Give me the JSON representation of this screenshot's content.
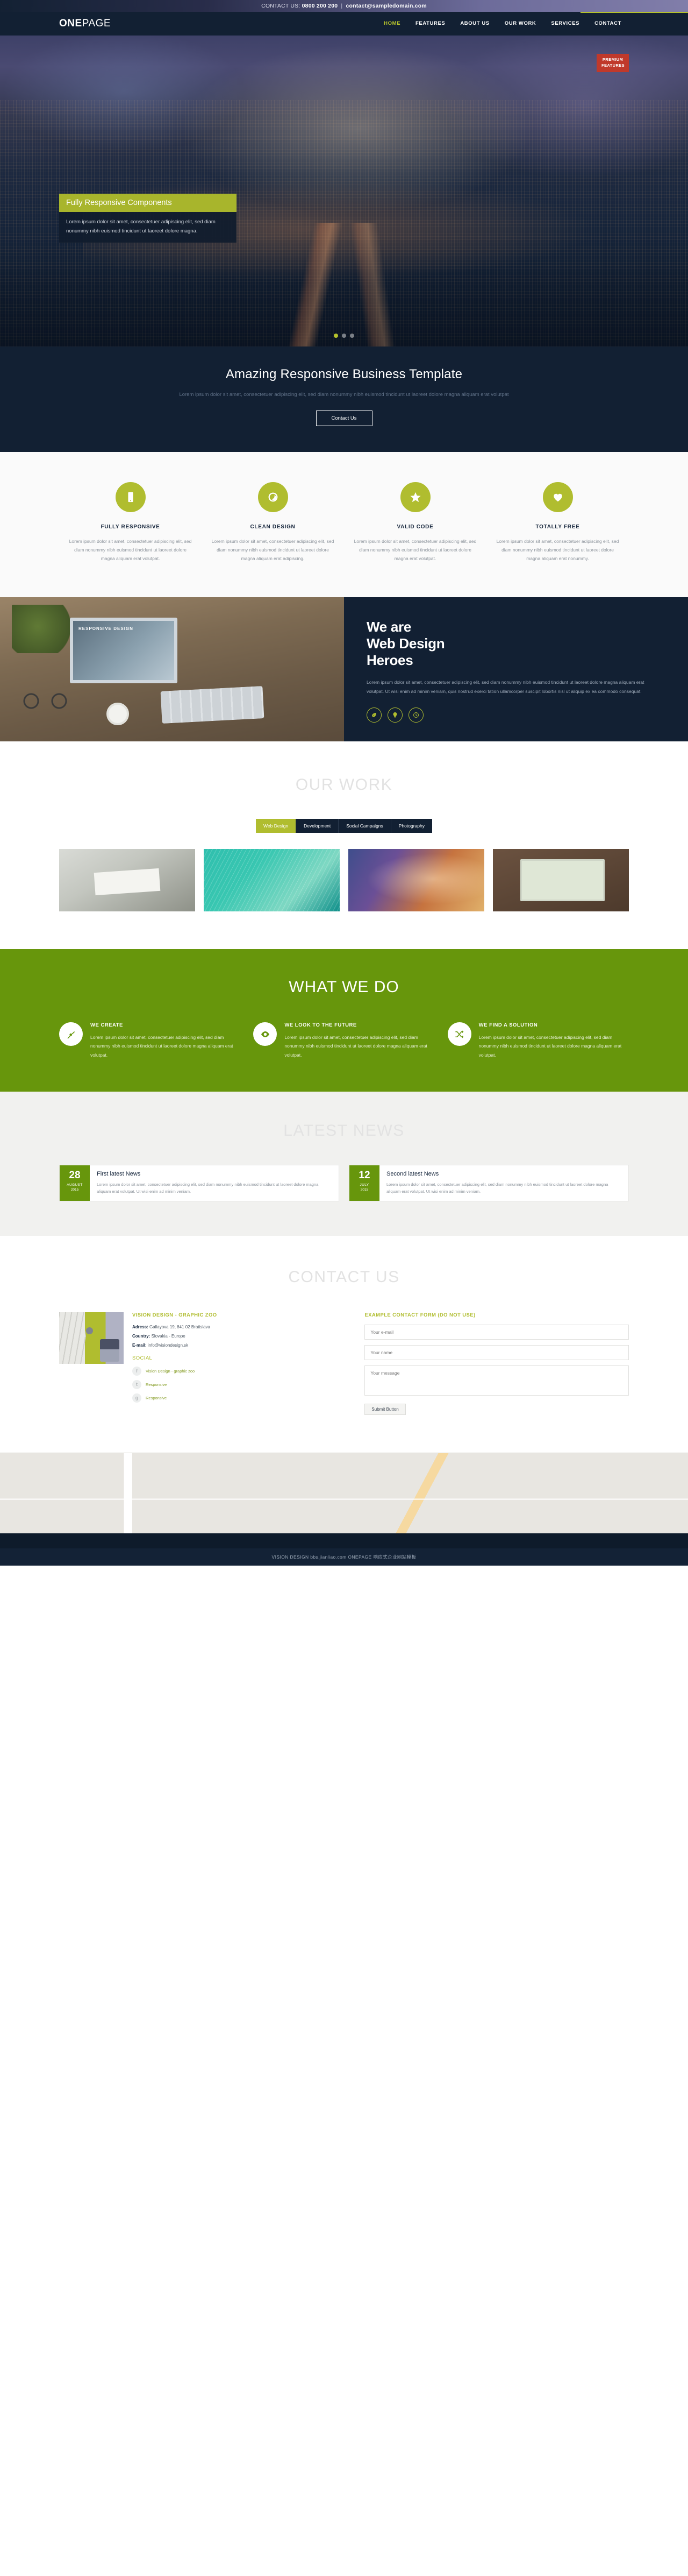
{
  "topbar": {
    "label": "CONTACT US:",
    "phone": "0800 200 200",
    "separator": "|",
    "email": "contact@sampledomain.com"
  },
  "header": {
    "logo_bold": "ONE",
    "logo_light": "PAGE",
    "nav": [
      {
        "label": "HOME",
        "active": true
      },
      {
        "label": "FEATURES",
        "active": false
      },
      {
        "label": "ABOUT US",
        "active": false
      },
      {
        "label": "OUR WORK",
        "active": false
      },
      {
        "label": "SERVICES",
        "active": false
      },
      {
        "label": "CONTACT",
        "active": false
      }
    ]
  },
  "hero": {
    "badge_line1": "PREMIUM",
    "badge_line2": "FEATURES",
    "caption_title": "Fully Responsive Components",
    "caption_body": "Lorem ipsum dolor sit amet, consectetuer adipiscing elit, sed diam nonummy nibh euismod tincidunt ut laoreet dolore magna."
  },
  "tagline": {
    "title": "Amazing Responsive Business Template",
    "subtitle": "Lorem ipsum dolor sit amet, consectetuer adipiscing elit, sed diam nonummy nibh euismod tincidunt ut laoreet dolore magna aliquam erat volutpat",
    "button": "Contact Us"
  },
  "features": [
    {
      "icon": "mobile-icon",
      "title": "FULLY RESPONSIVE",
      "text": "Lorem ipsum dolor sit amet, consectetuer adipiscing elit, sed diam nonummy nibh euismod tincidunt ut laoreet dolore magna aliquam erat volutpat."
    },
    {
      "icon": "eye-icon",
      "title": "CLEAN DESIGN",
      "text": "Lorem ipsum dolor sit amet, consectetuer adipiscing elit, sed diam nonummy nibh euismod tincidunt ut laoreet dolore magna aliquam erat adipiscing."
    },
    {
      "icon": "star-icon",
      "title": "VALID CODE",
      "text": "Lorem ipsum dolor sit amet, consectetuer adipiscing elit, sed diam nonummy nibh euismod tincidunt ut laoreet dolore magna erat volutpat."
    },
    {
      "icon": "heart-icon",
      "title": "TOTALLY FREE",
      "text": "Lorem ipsum dolor sit amet, consectetuer adipiscing elit, sed diam nonummy nibh euismod tincidunt ut laoreet dolore magna aliquam erat nonummy."
    }
  ],
  "about": {
    "screen_label": "RESPONSIVE DESIGN",
    "heading_line1": "We are",
    "heading_line2": "Web Design",
    "heading_line3": "Heroes",
    "body": "Lorem ipsum dolor sit amet, consectetuer adipiscing elit, sed diam nonummy nibh euismod tincidunt ut laoreet dolore magna aliquam erat volutpat. Ut wisi enim ad minim veniam, quis nostrud exerci tation ullamcorper suscipit lobortis nisl ut aliquip ex ea commodo consequat.",
    "icons": [
      "leaf-icon",
      "bulb-icon",
      "clock-icon"
    ]
  },
  "work": {
    "title": "OUR WORK",
    "filters": [
      {
        "label": "Web Design",
        "active": true
      },
      {
        "label": "Development",
        "active": false
      },
      {
        "label": "Social Campaigns",
        "active": false
      },
      {
        "label": "Photography",
        "active": false
      }
    ],
    "items": [
      {
        "name": "seo-newspaper-thumb"
      },
      {
        "name": "teal-abstract-thumb"
      },
      {
        "name": "colorful-paint-thumb"
      },
      {
        "name": "laptop-homepage-thumb"
      }
    ]
  },
  "what_we_do": {
    "title": "WHAT WE DO",
    "items": [
      {
        "icon": "brush-icon",
        "title": "WE CREATE",
        "text": "Lorem ipsum dolor sit amet, consectetuer adipiscing elit, sed diam nonummy nibh euismod tincidunt ut laoreet dolore magna aliquam erat volutpat."
      },
      {
        "icon": "eye-icon",
        "title": "WE LOOK TO THE FUTURE",
        "text": "Lorem ipsum dolor sit amet, consectetuer adipiscing elit, sed diam nonummy nibh euismod tincidunt ut laoreet dolore magna aliquam erat volutpat."
      },
      {
        "icon": "shuffle-icon",
        "title": "WE FIND A SOLUTION",
        "text": "Lorem ipsum dolor sit amet, consectetuer adipiscing elit, sed diam nonummy nibh euismod tincidunt ut laoreet dolore magna aliquam erat volutpat."
      }
    ]
  },
  "news": {
    "title": "LATEST NEWS",
    "items": [
      {
        "day": "28",
        "month": "AUGUST",
        "year": "2015",
        "title": "First latest News",
        "text": "Lorem ipsum dolor sit amet, consectetuer adipiscing elit, sed diam nonummy nibh euismod tincidunt ut laoreet dolore magna aliquam erat volutpat. Ut wisi enim ad minim veniam."
      },
      {
        "day": "12",
        "month": "JULY",
        "year": "2015",
        "title": "Second latest News",
        "text": "Lorem ipsum dolor sit amet, consectetuer adipiscing elit, sed diam nonummy nibh euismod tincidunt ut laoreet dolore magna aliquam erat volutpat. Ut wisi enim ad minim veniam."
      }
    ]
  },
  "contact": {
    "title": "CONTACT US",
    "company": "VISION DESIGN - GRAPHIC ZOO",
    "address_label": "Adress:",
    "address_value": "Gallayova 19, 841 02 Bratislava",
    "country_label": "Country:",
    "country_value": "Slovakia - Europe",
    "email_label": "E-mail:",
    "email_value": "info@visiondesign.sk",
    "social_title": "SOCIAL",
    "social": [
      {
        "icon": "facebook-icon",
        "glyph": "f",
        "label": "Vision Design - graphic zoo"
      },
      {
        "icon": "twitter-icon",
        "glyph": "t",
        "label": "Responsive"
      },
      {
        "icon": "google-plus-icon",
        "glyph": "g",
        "label": "Responsive"
      }
    ],
    "form_title": "EXAMPLE CONTACT FORM (DO NOT USE)",
    "email_placeholder": "Your e-mail",
    "name_placeholder": "Your name",
    "message_placeholder": "Your message",
    "submit_label": "Submit Button"
  },
  "footer": {
    "text": "VISION DESIGN bbs.jianliao.com  ONEPAGE 响应式企业网站模板"
  }
}
